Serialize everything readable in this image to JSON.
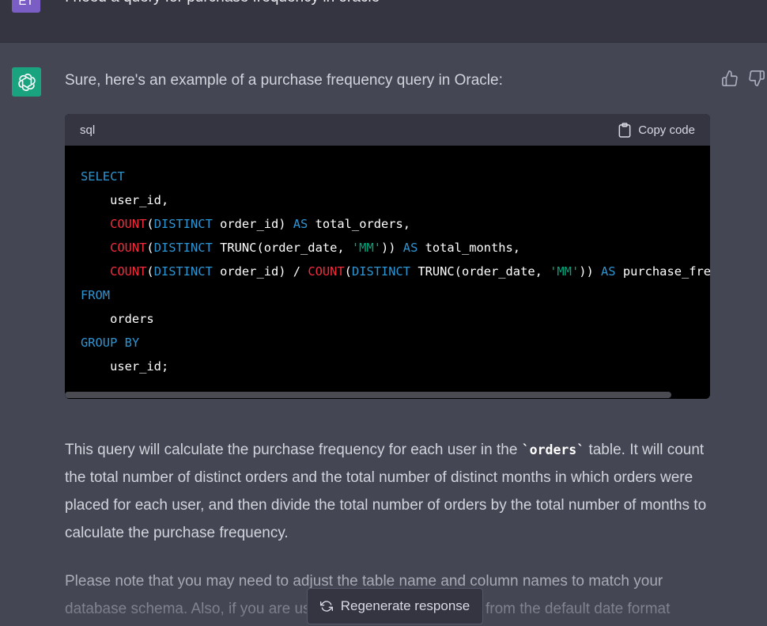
{
  "user_message": {
    "avatar_initials": "ET",
    "text": "I need a query for purchase frequency in oracle"
  },
  "assistant": {
    "intro": "Sure, here's an example of a purchase frequency query in Oracle:",
    "code_block": {
      "language": "sql",
      "copy_label": "Copy code",
      "lines": {
        "l1_kw": "SELECT",
        "l2": "user_id,",
        "l3_fn": "COUNT",
        "l3_kw": "DISTINCT",
        "l3_text": " order_id) ",
        "l3_as": "AS",
        "l3_tail": " total_orders,",
        "l4_fn": "COUNT",
        "l4_kw": "DISTINCT",
        "l4_text": " TRUNC(order_date, ",
        "l4_str": "'MM'",
        "l4_text2": ")) ",
        "l4_as": "AS",
        "l4_tail": " total_months,",
        "l5_fn": "COUNT",
        "l5_kw": "DISTINCT",
        "l5_text": " order_id) / ",
        "l5_fn2": "COUNT",
        "l5_kw2": "DISTINCT",
        "l5_text2": " TRUNC(order_date, ",
        "l5_str": "'MM'",
        "l5_text3": ")) ",
        "l5_as": "AS",
        "l5_tail": " purchase_freque",
        "l6_kw": "FROM",
        "l7": "orders",
        "l8_kw": "GROUP BY",
        "l9": "user_id;"
      }
    },
    "para1_a": "This query will calculate the purchase frequency for each user in the ",
    "para1_code": "`orders`",
    "para1_b": " table. It will count the total number of distinct orders and the total number of distinct months in which orders were placed for each user, and then divide the total number of orders by the total number of months to calculate the purchase frequency.",
    "para2": "Please note that you may need to adjust the table name and column names to match your database schema. Also, if you are using a different date format from the default date format",
    "feedback": {
      "thumbs_up": "thumbs-up-icon",
      "thumbs_down": "thumbs-down-icon"
    }
  },
  "regenerate_label": "Regenerate response",
  "colors": {
    "background": "#444654",
    "user_row": "#343541",
    "gpt_avatar": "#19a37f",
    "code_bg": "#000000",
    "keyword": "#2e95d3",
    "function": "#f22c3d",
    "string": "#00a67d"
  }
}
